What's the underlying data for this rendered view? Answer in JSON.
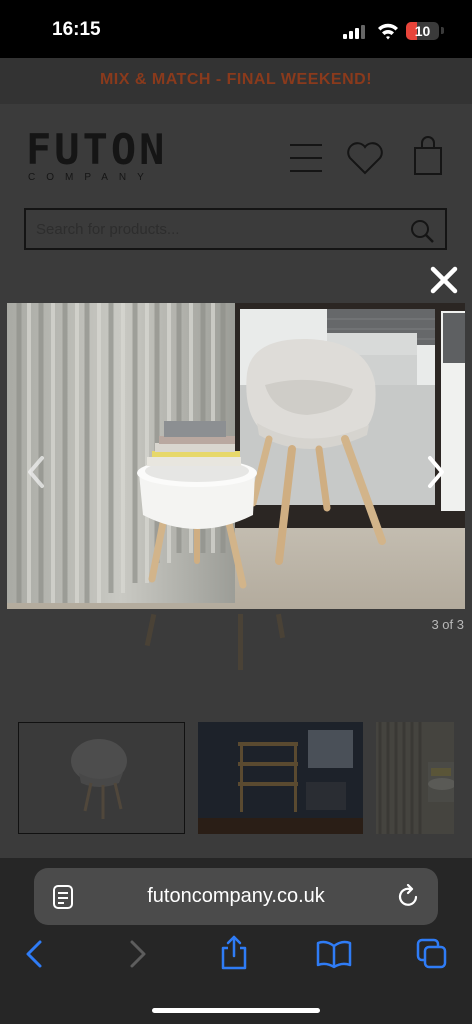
{
  "status_bar": {
    "time": "16:15",
    "battery_level": "10",
    "battery_color": "#e8443a"
  },
  "site": {
    "promo_text": "MIX & MATCH - FINAL WEEKEND!",
    "promo_color": "#8a3a1c",
    "logo_word": "FUTON",
    "logo_sub": "COMPANY",
    "search_placeholder": "Search for products...",
    "icons": [
      "menu-icon",
      "heart-icon",
      "bag-icon",
      "search-icon"
    ]
  },
  "gallery": {
    "counter": "3 of 3",
    "current_index": 3,
    "total": 3,
    "icons": [
      "close-icon",
      "chevron-left-icon",
      "chevron-right-icon"
    ]
  },
  "browser": {
    "url": "futoncompany.co.uk",
    "accent_color": "#2f7cf6",
    "icons": [
      "reader-icon",
      "reload-icon",
      "back-icon",
      "forward-icon",
      "share-icon",
      "bookmarks-icon",
      "tabs-icon"
    ]
  }
}
